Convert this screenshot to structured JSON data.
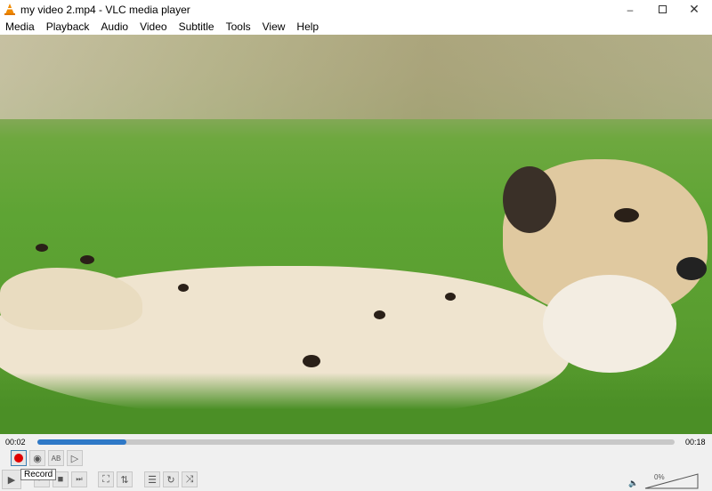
{
  "window": {
    "title": "my video 2.mp4 - VLC media player"
  },
  "menu": [
    "Media",
    "Playback",
    "Audio",
    "Video",
    "Subtitle",
    "Tools",
    "View",
    "Help"
  ],
  "player": {
    "elapsed": "00:02",
    "total": "00:18",
    "progress_fraction": 0.14,
    "volume_label": "0%",
    "tooltip": "Record",
    "accent": "#2f79c7",
    "record_color": "#e00000"
  }
}
